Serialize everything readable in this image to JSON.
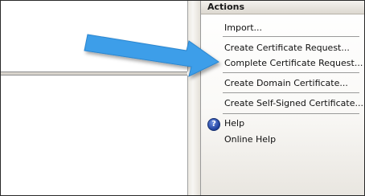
{
  "actions": {
    "title": "Actions",
    "import_label": "Import...",
    "create_request_label": "Create Certificate Request...",
    "complete_request_label": "Complete Certificate Request...",
    "domain_certificate_label": "Create Domain Certificate...",
    "self_signed_label": "Create Self-Signed Certificate...",
    "help_label": "Help",
    "online_help_label": "Online Help"
  },
  "icons": {
    "help": "help-icon",
    "pointer_arrow": "pointer-arrow-icon"
  },
  "colors": {
    "arrow": "#3d9ee9",
    "help_icon": "#2a4fb8"
  }
}
